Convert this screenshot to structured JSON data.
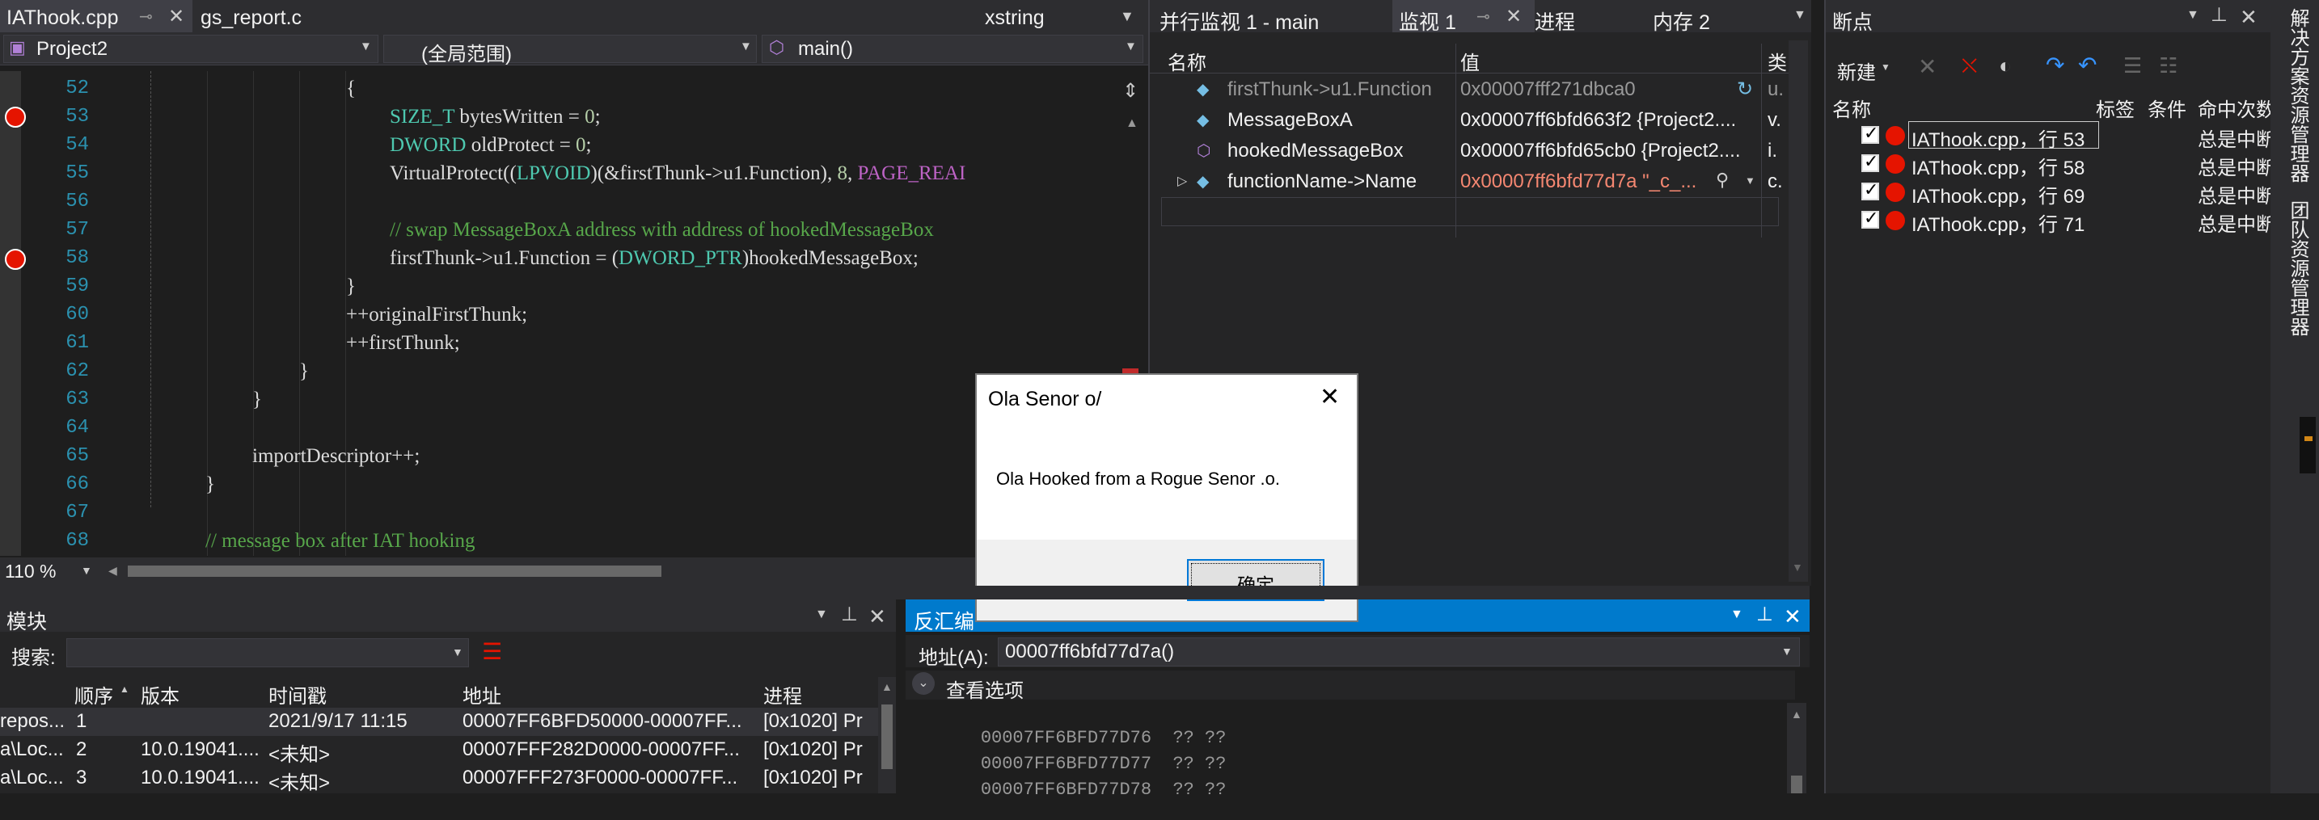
{
  "editor": {
    "tabs": [
      {
        "label": "IAThook.cpp"
      },
      {
        "label": "gs_report.c"
      }
    ],
    "right_tab": "xstring",
    "project_dropdown": "Project2",
    "scope_dropdown": "(全局范围)",
    "function_dropdown": "main()",
    "zoom": "110 %",
    "lines": [
      {
        "n": "52"
      },
      {
        "n": "53"
      },
      {
        "n": "54"
      },
      {
        "n": "55"
      },
      {
        "n": "56"
      },
      {
        "n": "57"
      },
      {
        "n": "58"
      },
      {
        "n": "59"
      },
      {
        "n": "60"
      },
      {
        "n": "61"
      },
      {
        "n": "62"
      },
      {
        "n": "63"
      },
      {
        "n": "64"
      },
      {
        "n": "65"
      },
      {
        "n": "66"
      },
      {
        "n": "67"
      },
      {
        "n": "68"
      }
    ],
    "code": {
      "l52": "{",
      "l53_type": "SIZE_T",
      "l53_rest": " bytesWritten = ",
      "l53_num": "0",
      "l53_end": ";",
      "l54_type": "DWORD",
      "l54_rest": " oldProtect = ",
      "l54_num": "0",
      "l54_end": ";",
      "l55_a": "VirtualProtect((",
      "l55_type": "LPVOID",
      "l55_b": ")(&firstThunk->u1.Function), ",
      "l55_num": "8",
      "l55_c": ", ",
      "l55_macro": "PAGE_REAI",
      "l57": "// swap MessageBoxA address with address of hookedMessageBox",
      "l58_a": "firstThunk->u1.Function = (",
      "l58_type": "DWORD_PTR",
      "l58_b": ")hookedMessageBox;",
      "l59": "}",
      "l60": "++originalFirstThunk;",
      "l61": "++firstThunk;",
      "l62": "}",
      "l63": "}",
      "l65": "importDescriptor++;",
      "l66": "}",
      "l68": "// message box after IAT hooking"
    }
  },
  "watch": {
    "tabs": [
      "并行监视 1 - main",
      "监视 1",
      "进程",
      "内存 2"
    ],
    "columns": [
      "名称",
      "值",
      "类"
    ],
    "rows": [
      {
        "name": "firstThunk->u1.Function",
        "value": "0x00007fff271dbca0",
        "type": "u."
      },
      {
        "name": "MessageBoxA",
        "value": "0x00007ff6bfd663f2 {Project2....",
        "type": "v."
      },
      {
        "name": "hookedMessageBox",
        "value": "0x00007ff6bfd65cb0 {Project2....",
        "type": "i."
      },
      {
        "name": "functionName->Name",
        "value": "0x00007ff6bfd77d7a \"_c_...",
        "type": "c."
      }
    ]
  },
  "breakpoints": {
    "title": "断点",
    "new_button": "新建",
    "columns": [
      "名称",
      "标签",
      "条件",
      "命中次数"
    ],
    "items": [
      {
        "label": "IAThook.cpp，行 53",
        "hit": "总是中断"
      },
      {
        "label": "IAThook.cpp，行 58",
        "hit": "总是中断"
      },
      {
        "label": "IAThook.cpp，行 69",
        "hit": "总是中断"
      },
      {
        "label": "IAThook.cpp，行 71",
        "hit": "总是中断"
      }
    ]
  },
  "side_tabs": [
    "解决方案资源管理器",
    "团队资源管理器"
  ],
  "modules": {
    "title": "模块",
    "search_label": "搜索:",
    "columns": [
      "顺序",
      "版本",
      "时间戳",
      "地址",
      "进程"
    ],
    "rows": [
      {
        "path": "repos...",
        "order": "1",
        "version": "",
        "time": "2021/9/17 11:15",
        "address": "00007FF6BFD50000-00007FF...",
        "process": "[0x1020] Pr"
      },
      {
        "path": "a\\Loc...",
        "order": "2",
        "version": "10.0.19041....",
        "time": "<未知>",
        "address": "00007FFF282D0000-00007FF...",
        "process": "[0x1020] Pr"
      },
      {
        "path": "a\\Loc...",
        "order": "3",
        "version": "10.0.19041....",
        "time": "<未知>",
        "address": "00007FFF273F0000-00007FF...",
        "process": "[0x1020] Pr"
      }
    ]
  },
  "disasm": {
    "title": "反汇编",
    "address_label": "地址(A):",
    "address_value": "00007ff6bfd77d7a()",
    "view_options": "查看选项",
    "lines": [
      {
        "addr": "00007FF6BFD77D76",
        "bytes": "?? ??"
      },
      {
        "addr": "00007FF6BFD77D77",
        "bytes": "?? ??"
      },
      {
        "addr": "00007FF6BFD77D78",
        "bytes": "?? ??"
      }
    ]
  },
  "dialog": {
    "title": "Ola Senor o/",
    "message": "Ola Hooked from a Rogue Senor .o.",
    "ok_button": "确定"
  }
}
